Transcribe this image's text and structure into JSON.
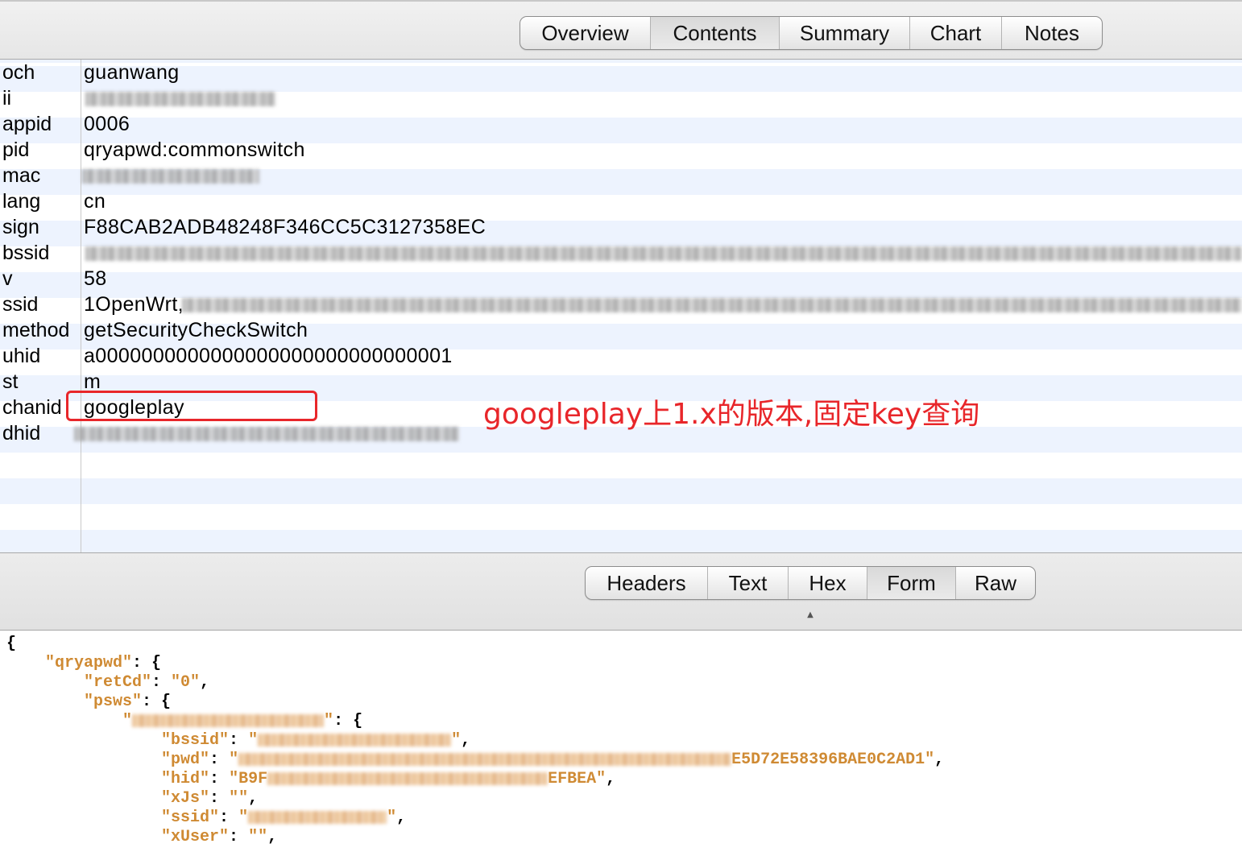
{
  "top_tabs": [
    {
      "label": "Overview",
      "selected": false
    },
    {
      "label": "Contents",
      "selected": true
    },
    {
      "label": "Summary",
      "selected": false
    },
    {
      "label": "Chart",
      "selected": false
    },
    {
      "label": "Notes",
      "selected": false
    }
  ],
  "form_rows": [
    {
      "key": "och",
      "value": "guanwang"
    },
    {
      "key": "ii",
      "value": ""
    },
    {
      "key": "appid",
      "value": "0006"
    },
    {
      "key": "pid",
      "value": "qryapwd:commonswitch"
    },
    {
      "key": "mac",
      "value": ""
    },
    {
      "key": "lang",
      "value": "cn"
    },
    {
      "key": "sign",
      "value": "F88CAB2ADB48248F346CC5C3127358EC"
    },
    {
      "key": "bssid",
      "value": ""
    },
    {
      "key": "v",
      "value": "58"
    },
    {
      "key": "ssid",
      "value": "1OpenWrt,"
    },
    {
      "key": "method",
      "value": "getSecurityCheckSwitch"
    },
    {
      "key": "uhid",
      "value": "a0000000000000000000000000000001"
    },
    {
      "key": "st",
      "value": "m"
    },
    {
      "key": "chanid",
      "value": "googleplay"
    },
    {
      "key": "dhid",
      "value": ""
    }
  ],
  "annotation": {
    "text": "googleplay上1.x的版本,固定key查询",
    "color": "#e8262a"
  },
  "bottom_tabs": [
    {
      "label": "Headers",
      "selected": false
    },
    {
      "label": "Text",
      "selected": false
    },
    {
      "label": "Hex",
      "selected": false
    },
    {
      "label": "Form",
      "selected": true
    },
    {
      "label": "Raw",
      "selected": false
    }
  ],
  "json_view": {
    "open_brace": "{",
    "k_qryapwd": "\"qryapwd\"",
    "k_retCd": "\"retCd\"",
    "v_retCd": "\"0\"",
    "k_psws": "\"psws\"",
    "k_bssid": "\"bssid\"",
    "k_pwd": "\"pwd\"",
    "v_pwd_tail": "E5D72E58396BAE0C2AD1\"",
    "k_hid": "\"hid\"",
    "v_hid_head": "\"B9F",
    "v_hid_tail": "EFBEA\"",
    "k_xJs": "\"xJs\"",
    "v_xJs": "\"\"",
    "k_ssid": "\"ssid\"",
    "k_xUser": "\"xUser\"",
    "v_xUser": "\"\""
  },
  "colors": {
    "json_key": "#cf8a33",
    "row_stripe": "#edf3fe",
    "highlight": "#e8262a"
  }
}
